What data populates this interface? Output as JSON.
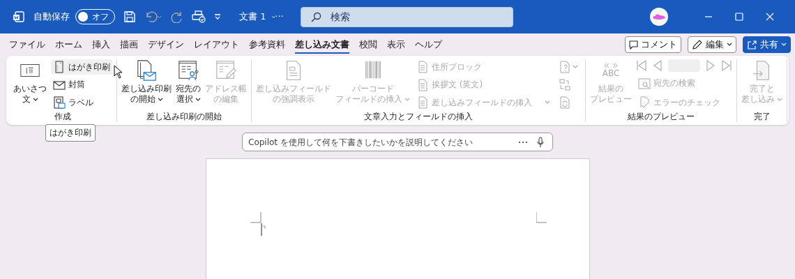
{
  "titlebar": {
    "autosave": {
      "label": "自動保存",
      "state": "オフ",
      "on": false
    },
    "undo_disabled": true,
    "redo_disabled": true,
    "title": "文書 1  -···",
    "search": {
      "placeholder": "検索"
    }
  },
  "tabs": [
    {
      "label": "ファイル",
      "selected": false
    },
    {
      "label": "ホーム",
      "selected": false
    },
    {
      "label": "挿入",
      "selected": false
    },
    {
      "label": "描画",
      "selected": false
    },
    {
      "label": "デザイン",
      "selected": false
    },
    {
      "label": "レイアウト",
      "selected": false
    },
    {
      "label": "参考資料",
      "selected": false
    },
    {
      "label": "差し込み文書",
      "selected": true
    },
    {
      "label": "校閲",
      "selected": false
    },
    {
      "label": "表示",
      "selected": false
    },
    {
      "label": "ヘルプ",
      "selected": false
    }
  ],
  "tab_actions": [
    {
      "label": "コメント",
      "kind": "comment"
    },
    {
      "label": "編集",
      "kind": "edit"
    },
    {
      "label": "共有",
      "kind": "share"
    }
  ],
  "ribbon": {
    "groups": [
      {
        "label": "作成",
        "columns": [
          {
            "kind": "large",
            "items": [
              {
                "lines": [
                  "あいさつ",
                  "文"
                ],
                "dropdown": true,
                "disabled": false
              }
            ]
          },
          {
            "kind": "small",
            "items": [
              {
                "label": "はがき印刷",
                "dropdown": false,
                "disabled": false,
                "hovered": true
              },
              {
                "label": "封筒",
                "dropdown": false,
                "disabled": false,
                "hovered": false
              },
              {
                "label": "ラベル",
                "dropdown": false,
                "disabled": false,
                "hovered": false
              }
            ]
          }
        ]
      },
      {
        "label": "差し込み印刷の開始",
        "columns": [
          {
            "kind": "large",
            "items": [
              {
                "lines": [
                  "差し込み印刷",
                  "の開始"
                ],
                "dropdown": true,
                "disabled": false
              }
            ]
          },
          {
            "kind": "large",
            "items": [
              {
                "lines": [
                  "宛先の",
                  "選択"
                ],
                "dropdown": true,
                "disabled": false
              }
            ]
          },
          {
            "kind": "large",
            "items": [
              {
                "lines": [
                  "アドレス帳",
                  "の編集"
                ],
                "dropdown": false,
                "disabled": true
              }
            ]
          }
        ]
      },
      {
        "label": "文章入力とフィールドの挿入",
        "columns": [
          {
            "kind": "large",
            "items": [
              {
                "lines": [
                  "差し込みフィールド",
                  "の強調表示"
                ],
                "dropdown": false,
                "disabled": true
              }
            ]
          },
          {
            "kind": "large",
            "items": [
              {
                "lines": [
                  "バーコード",
                  "フィールドの挿入"
                ],
                "dropdown": true,
                "disabled": true
              }
            ]
          },
          {
            "kind": "small",
            "items": [
              {
                "label": "住所ブロック",
                "dropdown": false,
                "disabled": true,
                "hovered": false
              },
              {
                "label": "挨拶文 (英文)",
                "dropdown": false,
                "disabled": true,
                "hovered": false
              },
              {
                "label": "差し込みフィールドの挿入",
                "dropdown": true,
                "disabled": true,
                "hovered": false
              }
            ]
          },
          {
            "kind": "icons",
            "items": [
              {
                "dropdown": true,
                "disabled": true
              },
              {
                "dropdown": false,
                "disabled": true
              },
              {
                "dropdown": false,
                "disabled": true
              }
            ]
          }
        ]
      },
      {
        "label": "結果のプレビュー",
        "columns": [
          {
            "kind": "large",
            "items": [
              {
                "icon_text": "ABC",
                "lines": [
                  "結果の",
                  "プレビュー"
                ],
                "dropdown": false,
                "disabled": true
              }
            ]
          },
          {
            "kind": "nav",
            "disabled": true,
            "items": [
              {
                "label": "宛先の検索",
                "dropdown": false,
                "disabled": true,
                "hovered": false
              },
              {
                "label": "エラーのチェック",
                "dropdown": false,
                "disabled": true,
                "hovered": false
              }
            ]
          }
        ]
      },
      {
        "label": "完了",
        "columns": [
          {
            "kind": "large",
            "items": [
              {
                "lines": [
                  "完了と",
                  "差し込み"
                ],
                "dropdown": true,
                "disabled": true
              }
            ]
          }
        ]
      }
    ]
  },
  "tooltip": "はがき印刷",
  "copilot": {
    "placeholder": "Copilot を使用して何を下書きしたいかを説明してください"
  }
}
